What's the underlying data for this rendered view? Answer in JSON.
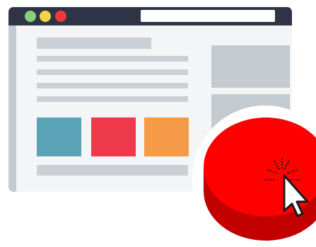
{
  "colors": {
    "titlebar": "#2f3346",
    "traffic_green": "#8bd17c",
    "traffic_yellow": "#f5d547",
    "traffic_red": "#f03b3b",
    "block_teal": "#5aa3b6",
    "block_red": "#ee3a4b",
    "block_orange": "#f59b47",
    "button_top": "#ff0000",
    "button_side": "#c20000"
  },
  "icons": {
    "cursor": "arrow-cursor-icon",
    "click": "click-burst-icon"
  }
}
